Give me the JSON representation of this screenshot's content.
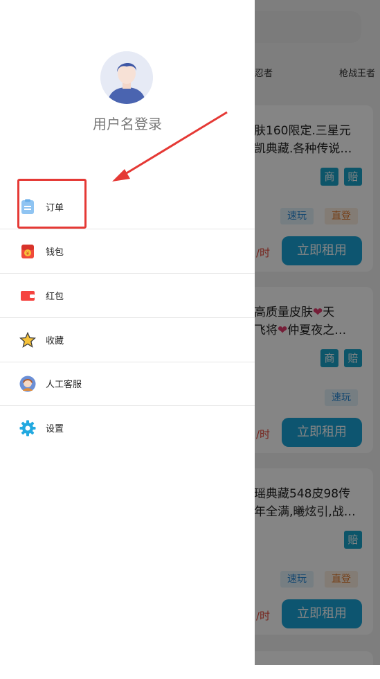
{
  "background": {
    "tabs": [
      "忍者",
      "枪战王者"
    ],
    "cards": [
      {
        "title_line1": "肤160限定.三星元",
        "title_line2": "凯典藏.各种传说…",
        "badges": [
          "商",
          "赔"
        ],
        "tags": [
          "速玩",
          "直登"
        ],
        "price_unit": "/时",
        "button": "立即租用"
      },
      {
        "title_part1": "高质量皮肤",
        "title_part2": "天",
        "title_part3": "飞将",
        "title_part4": "仲夏夜之…",
        "badges": [
          "商",
          "赔"
        ],
        "tags": [
          "速玩"
        ],
        "price_unit": "/时",
        "button": "立即租用"
      },
      {
        "title_line1": "瑶典藏548皮98传",
        "title_line2": "年全满,曦炫引,战…",
        "badges": [
          "赔"
        ],
        "tags": [
          "速玩",
          "直登"
        ],
        "price_unit": "/时",
        "button": "立即租用"
      }
    ]
  },
  "drawer": {
    "username": "用户名登录",
    "menu": [
      {
        "label": "订单",
        "icon": "order-icon"
      },
      {
        "label": "钱包",
        "icon": "wallet-icon"
      },
      {
        "label": "红包",
        "icon": "red-packet-icon"
      },
      {
        "label": "收藏",
        "icon": "star-icon"
      },
      {
        "label": "人工客服",
        "icon": "customer-service-icon"
      },
      {
        "label": "设置",
        "icon": "gear-icon"
      }
    ]
  },
  "colors": {
    "accent": "#1aa3d6",
    "annotation": "#e53935"
  }
}
